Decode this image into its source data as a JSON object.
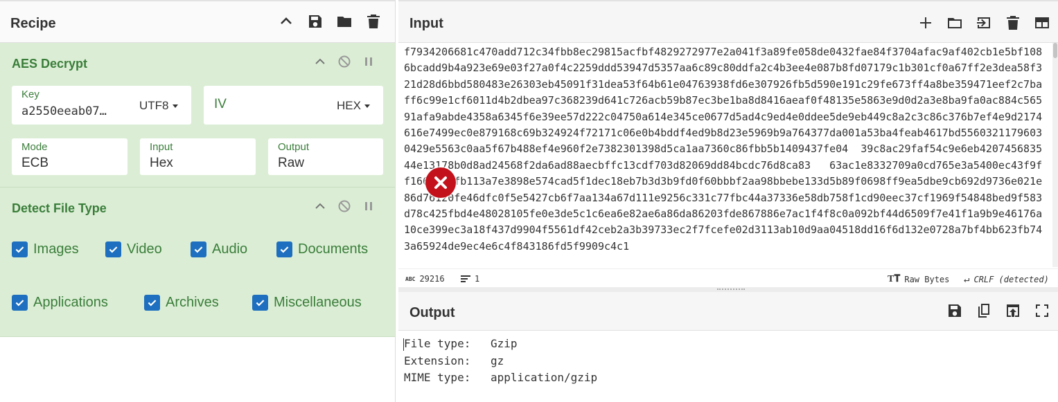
{
  "recipe": {
    "title": "Recipe",
    "icons": [
      "chevron-up-icon",
      "save-icon",
      "folder-icon",
      "trash-icon"
    ]
  },
  "aes": {
    "title": "AES Decrypt",
    "key_label": "Key",
    "key_value": "a2550eeab07…",
    "key_encoding": "UTF8",
    "iv_placeholder": "IV",
    "iv_encoding": "HEX",
    "mode_label": "Mode",
    "mode_value": "ECB",
    "input_label": "Input",
    "input_value": "Hex",
    "output_label": "Output",
    "output_value": "Raw"
  },
  "detect": {
    "title": "Detect File Type",
    "options": [
      {
        "label": "Images",
        "checked": true
      },
      {
        "label": "Video",
        "checked": true
      },
      {
        "label": "Audio",
        "checked": true
      },
      {
        "label": "Documents",
        "checked": true
      },
      {
        "label": "Applications",
        "checked": true
      },
      {
        "label": "Archives",
        "checked": true
      },
      {
        "label": "Miscellaneous",
        "checked": true
      }
    ]
  },
  "input": {
    "title": "Input",
    "text": "f7934206681c470add712c34fbb8ec29815acfbf4829272977e2a041f3a89fe058de0432fae84f3704afac9af402cb1e5bf1086bcadd9b4a923e69e03f27a0f4c2259ddd53947d5357aa6c89c80ddfa2c4b3ee4e087b8fd07179c1b301cf0a67ff2e3dea58f321d28d6bbd580483e26303eb45091f31dea53f64b61e04763938fd6e307926fb5d590e191c29fe673ff4a8be359471eef2c7baff6c99e1cf6011d4b2dbea97c368239d641c726acb59b87ec3be1ba8d8416aeaf0f48135e5863e9d0d2a3e8ba9fa0ac884c56591afa9abde4358a6345f6e39ee57d222c04750a614e345ce0677d5ad4c9ed4e0ddee5de9eb449c8a2c3c86c376b7ef4e9d2174616e7499ec0e879168c69b324924f72171c06e0b4bddf4ed9b8d23e5969b9a764377da001a53ba4feab4617bd55603211796030429e5563c0aa5f67b488ef4e960f2e7382301398d5ca1aa7360c86fbb5b1409437fe04  39c8ac29faf54c9e6eb420745683544e13178b0d8ad24568f2da6ad88aecbffc13cdf703d82069dd84bcdc76d8ca83   63ac1e8332709a0cd765e3a5400ec43f9ff1664a66fb113a7e3898e574cad5f1dec18eb7b3d3b9fd0f60bbbf2aa98bbebe133d5b89f0698ff9ea5dbe9cb692d9736e021e86d76120fe46dfc0f5e5427cb6f7aa134a67d111e9256c331c77fbc44a37336e58db758f1cd90eec37cf1969f54848bed9f583d78c425fbd4e48028105fe0e3de5c1c6ea6e82ae6a86da86203fde867886e7ac1f4f8c0a092bf44d6509f7e41f1a9b9e46176a10ce399ec3a18f437d9904f5561df42ceb2a3b39733ec2f7fcefe02d3113ab10d9aa04518dd16f6d132e0728a7bf4bb623fb743a65924de9ec4e6c4f843186fd5f9909c4c1",
    "stats_abc": "ABC",
    "length": "29216",
    "lines": "1",
    "raw_bytes": "Raw Bytes",
    "eol": "CRLF (detected)"
  },
  "output": {
    "title": "Output",
    "rows": [
      {
        "key": "File type:",
        "value": "Gzip"
      },
      {
        "key": "Extension:",
        "value": "gz"
      },
      {
        "key": "MIME type:",
        "value": "application/gzip"
      }
    ]
  },
  "colors": {
    "op_bg": "#dbeed5",
    "op_text": "#3a7d3a",
    "checkbox": "#1e6fbf",
    "cursor_marker": "#c3121c"
  }
}
